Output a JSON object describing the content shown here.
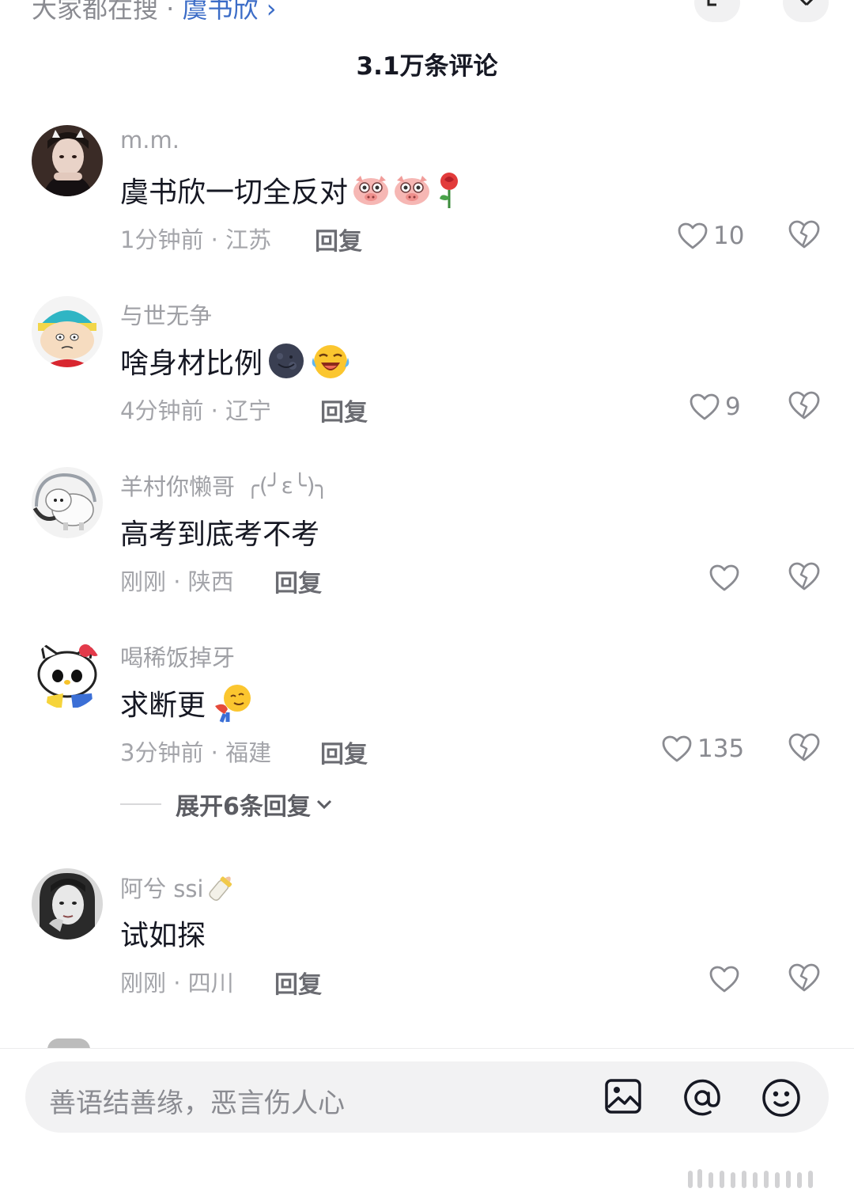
{
  "header": {
    "search_prefix": "大家都在搜 · ",
    "search_term": "虞书欣 ›",
    "comment_count": "3.1万条评论"
  },
  "comments": [
    {
      "username": "m.m.",
      "text": "虞书欣一切全反对",
      "emojis": [
        "pig-face-icon",
        "pig-face-icon",
        "rose-icon"
      ],
      "time_location": "1分钟前 · 江苏",
      "reply_label": "回复",
      "likes": "10"
    },
    {
      "username": "与世无争",
      "text": "啥身材比例",
      "emojis": [
        "dark-moon-face-icon",
        "laughing-face-icon"
      ],
      "time_location": "4分钟前 · 辽宁",
      "reply_label": "回复",
      "likes": "9"
    },
    {
      "username": "羊村你懒哥",
      "username_suffix": "╭(╯ε╰)╮",
      "text": "高考到底考不考",
      "emojis": [],
      "time_location": "刚刚 · 陕西",
      "reply_label": "回复",
      "likes": ""
    },
    {
      "username": "喝稀饭掉牙",
      "text": "求断更",
      "emojis": [
        "bowing-face-icon"
      ],
      "time_location": "3分钟前 · 福建",
      "reply_label": "回复",
      "likes": "135",
      "expand_label": "展开6条回复"
    },
    {
      "username": "阿兮 ssi",
      "username_emoji": "baby-bottle-icon",
      "text": "试如探",
      "emojis": [],
      "time_location": "刚刚 · 四川",
      "reply_label": "回复",
      "likes": ""
    }
  ],
  "input": {
    "placeholder": "善语结善缘，恶言伤人心"
  },
  "colors": {
    "accent_link": "#3b6cc7",
    "text_primary": "#161823",
    "text_secondary": "#a4a5aa"
  }
}
